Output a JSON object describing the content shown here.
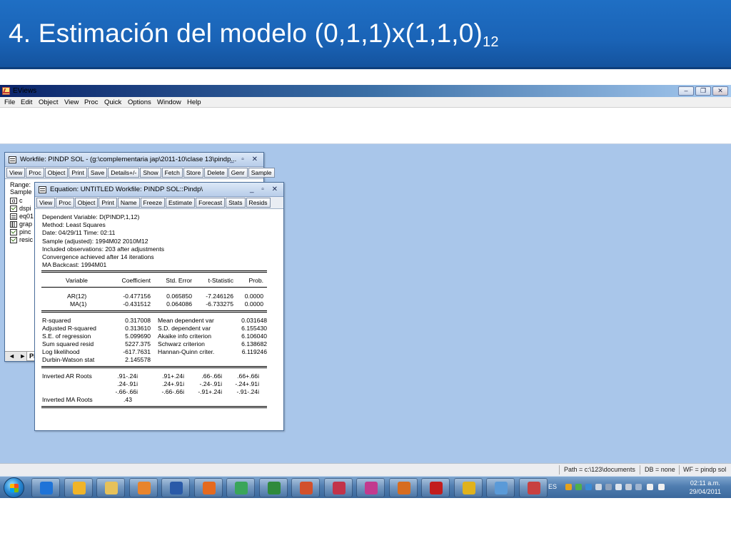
{
  "slide": {
    "title": "4. Estimación del modelo  (0,1,1)x(1,1,0)",
    "title_subscript": "12"
  },
  "app": {
    "name": "EViews",
    "menu": [
      "File",
      "Edit",
      "Object",
      "View",
      "Proc",
      "Quick",
      "Options",
      "Window",
      "Help"
    ],
    "status": {
      "path": "Path = c:\\123\\documents",
      "db": "DB = none",
      "wf": "WF = pindp sol"
    }
  },
  "workfile": {
    "title": "Workfile: PINDP SOL - (g:\\complementaria jap\\2011-10\\clase 13\\pindp...",
    "toolbar": [
      "View",
      "Proc",
      "Object",
      "Print",
      "Save",
      "Details+/-",
      "Show",
      "Fetch",
      "Store",
      "Delete",
      "Genr",
      "Sample"
    ],
    "range_label": "Range:",
    "sample_label": "Sample",
    "objects": [
      {
        "name": "c",
        "icon": "alpha-icon"
      },
      {
        "name": "dspi",
        "icon": "series-icon"
      },
      {
        "name": "eq01",
        "icon": "equation-icon"
      },
      {
        "name": "grap",
        "icon": "graph-icon"
      },
      {
        "name": "pinc",
        "icon": "series-icon"
      },
      {
        "name": "resic",
        "icon": "series-icon"
      }
    ],
    "tab_label": "Pin",
    "tab_arrows": "◄ ►"
  },
  "equation": {
    "title": "Equation: UNTITLED   Workfile: PINDP SOL::Pindp\\",
    "toolbar": [
      "View",
      "Proc",
      "Object",
      "Print",
      "Name",
      "Freeze",
      "Estimate",
      "Forecast",
      "Stats",
      "Resids"
    ],
    "header_lines": [
      "Dependent Variable: D(PINDP,1,12)",
      "Method: Least Squares",
      "Date: 04/29/11   Time: 02:11",
      "Sample (adjusted): 1994M02 2010M12",
      "Included observations: 203 after adjustments",
      "Convergence achieved after 14 iterations",
      "MA Backcast: 1994M01"
    ],
    "coef_headers": [
      "Variable",
      "Coefficient",
      "Std. Error",
      "t-Statistic",
      "Prob."
    ],
    "coef_rows": [
      [
        "AR(12)",
        "-0.477156",
        "0.065850",
        "-7.246126",
        "0.0000"
      ],
      [
        "MA(1)",
        "-0.431512",
        "0.064086",
        "-6.733275",
        "0.0000"
      ]
    ],
    "stats_rows": [
      [
        "R-squared",
        "0.317008",
        "Mean dependent var",
        "0.031648"
      ],
      [
        "Adjusted R-squared",
        "0.313610",
        "S.D. dependent var",
        "6.155430"
      ],
      [
        "S.E. of regression",
        "5.099690",
        "Akaike info criterion",
        "6.106040"
      ],
      [
        "Sum squared resid",
        "5227.375",
        "Schwarz criterion",
        "6.138682"
      ],
      [
        "Log likelihood",
        "-617.7631",
        "Hannan-Quinn criter.",
        "6.119246"
      ],
      [
        "Durbin-Watson stat",
        "2.145578",
        "",
        ""
      ]
    ],
    "roots": {
      "ar_label": "Inverted AR Roots",
      "ar_rows": [
        [
          ".91-.24i",
          ".91+.24i",
          ".66-.66i",
          ".66+.66i"
        ],
        [
          ".24-.91i",
          ".24+.91i",
          "-.24-.91i",
          "-.24+.91i"
        ],
        [
          "-.66-.66i",
          "-.66-.66i",
          "-.91+.24i",
          "-.91-.24i"
        ]
      ],
      "ma_label": "Inverted MA Roots",
      "ma_value": ".43"
    }
  },
  "taskbar": {
    "language": "ES",
    "time": "02:11 a.m.",
    "date": "29/04/2011",
    "apps": [
      {
        "name": "internet-explorer-icon",
        "color": "#1e73d8"
      },
      {
        "name": "outlook-icon",
        "color": "#f0b429"
      },
      {
        "name": "explorer-icon",
        "color": "#e6c15a"
      },
      {
        "name": "media-player-icon",
        "color": "#e8842c"
      },
      {
        "name": "word-icon",
        "color": "#2a5aa8"
      },
      {
        "name": "firefox-icon",
        "color": "#e56a1f"
      },
      {
        "name": "chrome-icon",
        "color": "#3aa55a"
      },
      {
        "name": "excel-icon",
        "color": "#2f8a3c"
      },
      {
        "name": "powerpoint-icon",
        "color": "#d2502b"
      },
      {
        "name": "calculator-icon",
        "color": "#c2334a"
      },
      {
        "name": "flower-app-icon",
        "color": "#c23a8e"
      },
      {
        "name": "matlab-icon",
        "color": "#d76c1f"
      },
      {
        "name": "acrobat-icon",
        "color": "#c21d1d"
      },
      {
        "name": "eye-app-icon",
        "color": "#e0b21c"
      },
      {
        "name": "paint-icon",
        "color": "#5a9ad8"
      },
      {
        "name": "eviews-taskbar-icon",
        "color": "#c84040"
      }
    ]
  }
}
